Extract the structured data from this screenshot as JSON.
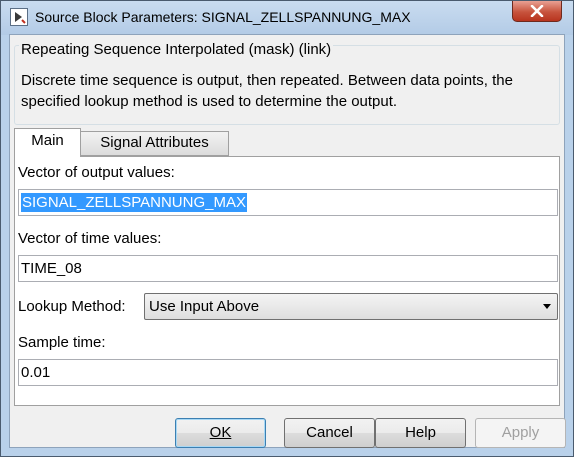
{
  "window": {
    "title": "Source Block Parameters: SIGNAL_ZELLSPANNUNG_MAX",
    "close_icon": "close-icon"
  },
  "mask": {
    "title": "Repeating Sequence Interpolated (mask) (link)",
    "description": "Discrete time sequence is output, then repeated.  Between data points, the specified lookup method is used to determine the output."
  },
  "tabs": [
    {
      "label": "Main",
      "active": true
    },
    {
      "label": "Signal Attributes",
      "active": false
    }
  ],
  "params": {
    "output_values_label": "Vector of output values:",
    "output_values": "SIGNAL_ZELLSPANNUNG_MAX",
    "time_values_label": "Vector of time values:",
    "time_values": "TIME_08",
    "lookup_label": "Lookup Method:",
    "lookup_value": "Use Input Above",
    "sample_time_label": "Sample time:",
    "sample_time": "0.01"
  },
  "buttons": {
    "ok": "OK",
    "cancel": "Cancel",
    "help": "Help",
    "apply": "Apply"
  }
}
